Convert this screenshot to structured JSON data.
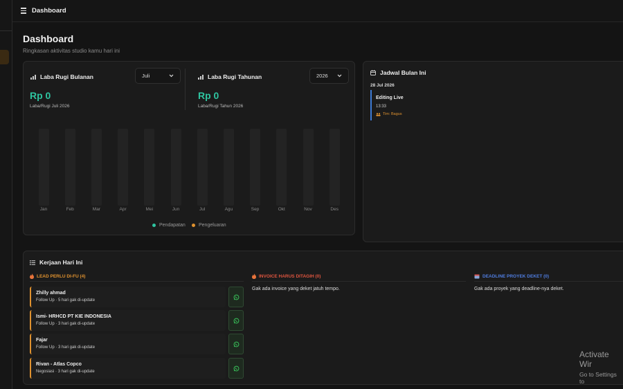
{
  "topbar": {
    "title": "Dashboard"
  },
  "page": {
    "title": "Dashboard",
    "subtitle": "Ringkasan aktivitas studio kamu hari ini"
  },
  "monthly": {
    "title": "Laba Rugi Bulanan",
    "select": "Juli",
    "amount": "Rp 0",
    "caption": "Laba/Rugi Juli 2026"
  },
  "yearly": {
    "title": "Laba Rugi Tahunan",
    "select": "2026",
    "amount": "Rp 0",
    "caption": "Laba/Rugi Tahun 2026"
  },
  "chart_data": {
    "type": "bar",
    "categories": [
      "Jan",
      "Feb",
      "Mar",
      "Apr",
      "Mei",
      "Jun",
      "Jul",
      "Agu",
      "Sep",
      "Okt",
      "Nov",
      "Des"
    ],
    "series": [
      {
        "name": "Pendapatan",
        "values": [
          0,
          0,
          0,
          0,
          0,
          0,
          0,
          0,
          0,
          0,
          0,
          0
        ],
        "color": "#2ec4a0"
      },
      {
        "name": "Pengeluaran",
        "values": [
          0,
          0,
          0,
          0,
          0,
          0,
          0,
          0,
          0,
          0,
          0,
          0
        ],
        "color": "#e0922f"
      }
    ],
    "legend": [
      "Pendapatan",
      "Pengeluaran"
    ],
    "legend_position": "bottom",
    "grid": false
  },
  "schedule": {
    "title": "Jadwal Bulan Ini",
    "date": "28 Jul 2026",
    "events": [
      {
        "title": "Editing Live",
        "time": "13:33",
        "team": "Tim: Bagus"
      }
    ]
  },
  "today": {
    "title": "Kerjaan Hari Ini",
    "leads": {
      "header": "LEAD PERLU DI-FU (4)",
      "items": [
        {
          "name": "Zhilly ahmad",
          "status": "Follow Up · 5 hari gak di-update"
        },
        {
          "name": "Ismi- HRHCD PT KIE INDONESIA",
          "status": "Follow Up · 3 hari gak di-update"
        },
        {
          "name": "Fajar",
          "status": "Follow Up · 3 hari gak di-update"
        },
        {
          "name": "Rivan - Atlas Copco",
          "status": "Negosiasi · 3 hari gak di-update"
        }
      ]
    },
    "invoices": {
      "header": "INVOICE HARUS DITAGIH (0)",
      "empty": "Gak ada invoice yang deket jatuh tempo."
    },
    "deadlines": {
      "header": "DEADLINE PROYEK DEKET (0)",
      "empty": "Gak ada proyek yang deadline-nya deket."
    }
  },
  "watermark": {
    "line1": "Activate Wir",
    "line2": "Go to Settings to"
  },
  "colors": {
    "accent_green": "#2ec4a0",
    "accent_orange": "#e0922f",
    "invoice_red": "#e0553f",
    "deadline_blue": "#4f7de0",
    "event_blue": "#3d7bd6"
  },
  "icons": {
    "menu": "hamburger-icon",
    "chart": "bar-chart-icon",
    "calendar": "calendar-icon",
    "list": "list-icon",
    "fire": "fire-icon",
    "chevron": "chevron-down-icon",
    "whatsapp": "whatsapp-icon",
    "team": "people-icon"
  }
}
